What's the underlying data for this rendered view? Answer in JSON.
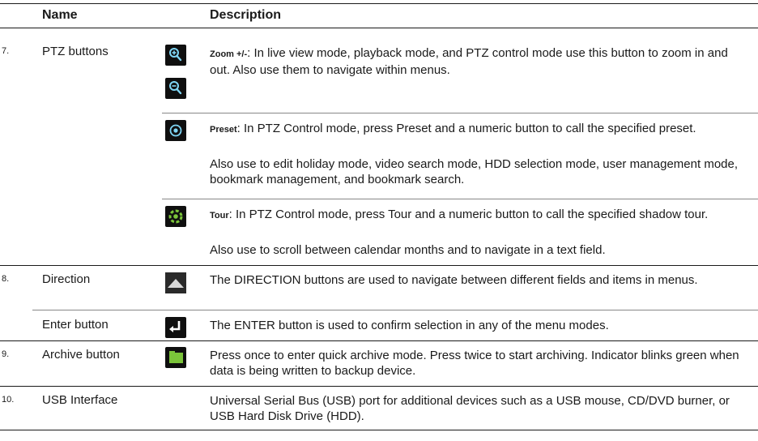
{
  "header": {
    "name": "Name",
    "description": "Description"
  },
  "rows": [
    {
      "number": "7.",
      "name": "PTZ buttons",
      "items": [
        {
          "icons": [
            "zoom-in-icon",
            "zoom-out-icon"
          ],
          "term": "Zoom +/-",
          "text": ": In live view mode, playback mode, and PTZ control mode use this button to zoom in and out. Also use them to navigate within menus."
        },
        {
          "icons": [
            "preset-icon"
          ],
          "term": "Preset",
          "text": ": In PTZ Control mode, press Preset and a numeric button to call the specified preset.",
          "extra": "Also use to edit holiday mode, video search mode, HDD selection mode, user management mode, bookmark management, and bookmark search."
        },
        {
          "icons": [
            "tour-icon"
          ],
          "term": "Tour",
          "text": ": In PTZ Control mode, press Tour and a numeric button to call the specified shadow tour.",
          "extra": "Also use to scroll between calendar months and to navigate in a text field."
        }
      ]
    },
    {
      "number": "8.",
      "name": "Direction",
      "icons": [
        "direction-up-icon"
      ],
      "text": "The DIRECTION buttons are used to navigate between different fields and items in menus."
    },
    {
      "number": "",
      "name": "Enter button",
      "icons": [
        "enter-icon"
      ],
      "text": "The ENTER button is used to confirm selection in any of the menu modes."
    },
    {
      "number": "9.",
      "name": "Archive button",
      "icons": [
        "archive-icon"
      ],
      "text": "Press once to enter quick archive mode. Press twice to start archiving. Indicator blinks green when data is being written to backup device."
    },
    {
      "number": "10.",
      "name": "USB Interface",
      "text": "Universal Serial Bus (USB) port for additional devices such as a USB mouse, CD/DVD burner, or USB Hard Disk Drive (HDD)."
    }
  ],
  "colors": {
    "icon_background": "#0f0f0f",
    "icon_blue": "#7fd6f5",
    "icon_green": "#7bc43a",
    "rule": "#1a1a1a"
  }
}
